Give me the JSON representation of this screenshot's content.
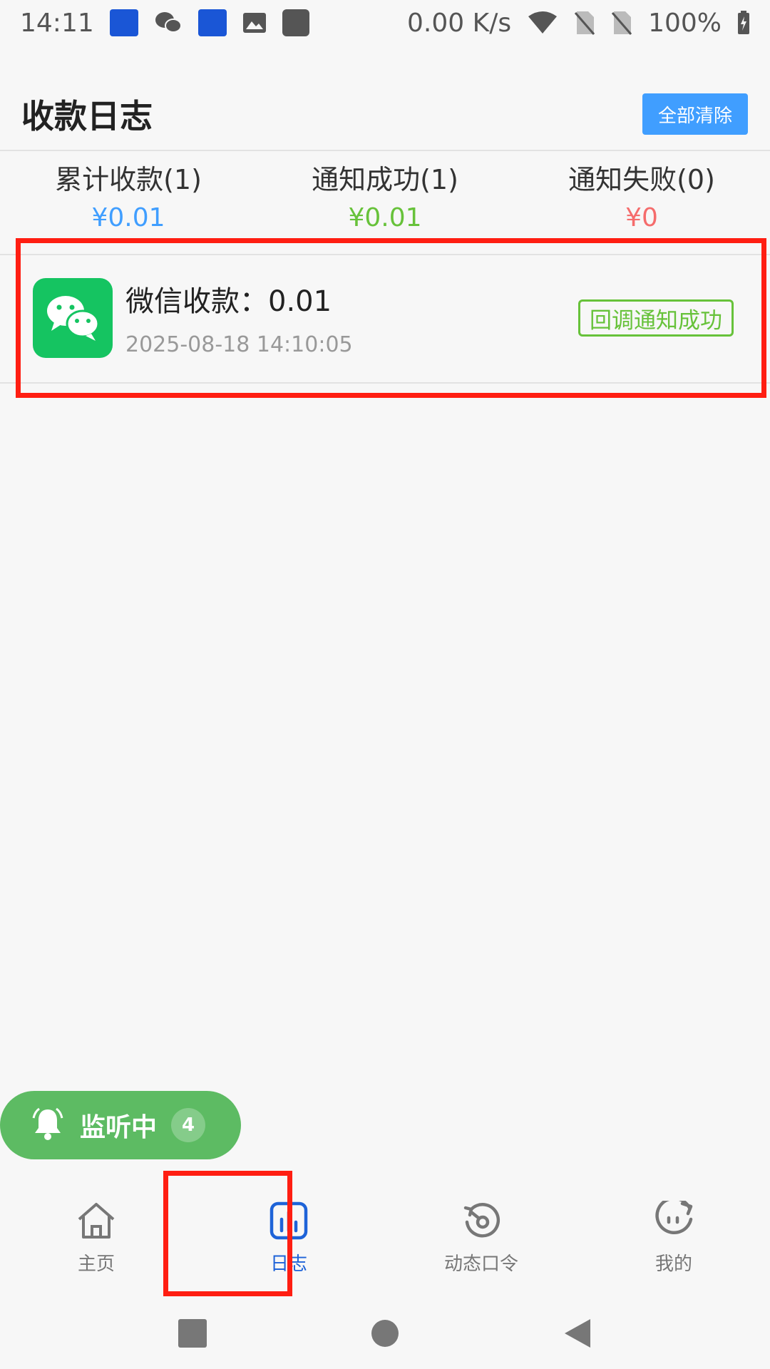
{
  "status_bar": {
    "time": "14:11",
    "network_speed": "0.00 K/s",
    "battery": "100%",
    "icons": [
      "app-icon",
      "wechat-icon",
      "app-icon",
      "image-icon",
      "square-icon",
      "wifi-icon",
      "no-sim-icon",
      "no-sim-icon",
      "battery-charging-icon"
    ]
  },
  "header": {
    "title": "收款日志",
    "clear_all_label": "全部清除"
  },
  "stats": [
    {
      "label": "累计收款(1)",
      "value": "¥0.01",
      "color": "#409eff"
    },
    {
      "label": "通知成功(1)",
      "value": "¥0.01",
      "color": "#67c23a"
    },
    {
      "label": "通知失败(0)",
      "value": "¥0",
      "color": "#f56c6c"
    }
  ],
  "logs": [
    {
      "icon": "wechat-icon",
      "title": "微信收款：0.01",
      "time": "2025-08-18 14:10:05",
      "status": "回调通知成功"
    }
  ],
  "monitor": {
    "label": "监听中",
    "count": "4",
    "color": "#5dbb63"
  },
  "tabs": [
    {
      "label": "主页",
      "icon": "home-icon",
      "active": false
    },
    {
      "label": "日志",
      "icon": "bar-chart-icon",
      "active": true
    },
    {
      "label": "动态口令",
      "icon": "rotate-key-icon",
      "active": false
    },
    {
      "label": "我的",
      "icon": "face-icon",
      "active": false
    }
  ],
  "colors": {
    "accent": "#409eff",
    "success": "#67c23a",
    "danger": "#f56c6c",
    "active_tab": "#1e63d8",
    "highlight": "#ff1e12"
  }
}
